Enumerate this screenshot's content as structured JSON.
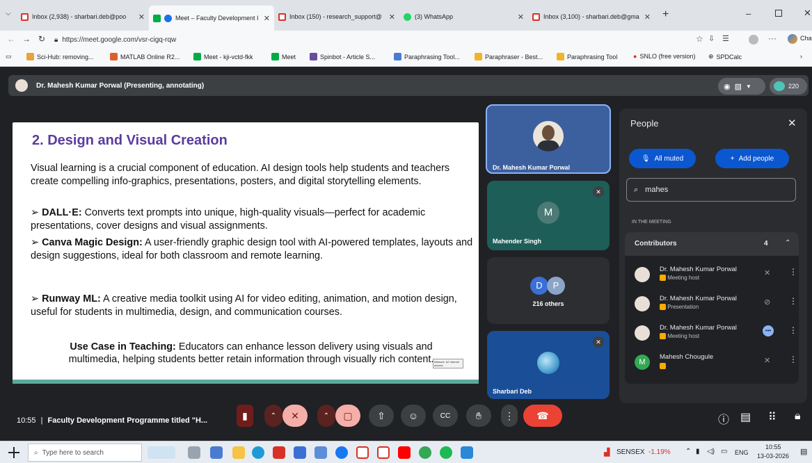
{
  "browser": {
    "tabs": [
      {
        "label": "Inbox (2,938) - sharbari.deb@poo"
      },
      {
        "label": "Meet – Faculty Development I"
      },
      {
        "label": "Inbox (150) - research_support@"
      },
      {
        "label": "(3) WhatsApp"
      },
      {
        "label": "Inbox (3,100) - sharbari.deb@gma"
      }
    ],
    "url": "https://meet.google.com/vsr-cigq-rqw",
    "chat_label": "Chat",
    "bookmarks": [
      "Sci-Hub: removing...",
      "MATLAB Online R2...",
      "Meet - kji-vctd-fkk",
      "Meet",
      "Spinbot - Article S...",
      "Paraphrasing Tool...",
      "Paraphraser - Best...",
      "Paraphrasing Tool",
      "SNLO (free version)",
      "SPDCalc"
    ]
  },
  "meet": {
    "presenter": "Dr. Mahesh Kumar Porwal (Presenting, annotating)",
    "participant_count": "220",
    "slide": {
      "title": "2. Design and Visual Creation",
      "intro": "Visual learning is a crucial component of education. AI design tools help students and teachers create compelling info-graphics, presentations, posters, and digital storytelling elements.",
      "bullets": [
        {
          "head": "DALL·E:",
          "text": " Converts text prompts into unique, high-quality visuals—perfect for academic presentations, cover designs and visual assignments."
        },
        {
          "head": "Canva Magic Design:",
          "text": " A user-friendly graphic design tool with AI-powered templates, layouts and design suggestions, ideal for both classroom and remote learning."
        },
        {
          "head": "Runway ML:",
          "text": " A creative media toolkit using AI for video editing, animation, and motion design, useful for students in multimedia, design, and communication courses."
        }
      ],
      "usecase_head": "Use Case in Teaching:",
      "usecase_text": " Educators can enhance lesson delivery using visuals and multimedia, helping students better retain information through visually rich content.",
      "tooltip": "Network: #2 Internet access"
    },
    "tiles": [
      {
        "name": "Dr. Mahesh Kumar Porwal"
      },
      {
        "name": "Mahender Singh",
        "initial": "M"
      },
      {
        "name": "216 others",
        "initials": [
          "D",
          "P"
        ]
      },
      {
        "name": "Sharbari Deb"
      }
    ],
    "people": {
      "title": "People",
      "all_muted": "All muted",
      "add_people": "Add people",
      "search_value": "mahes",
      "section": "IN THE MEETING",
      "group": "Contributors",
      "group_count": "4",
      "rows": [
        {
          "name": "Dr. Mahesh Kumar Porwal",
          "role": "Meeting host"
        },
        {
          "name": "Dr. Mahesh Kumar Porwal",
          "role": "Presentation"
        },
        {
          "name": "Dr. Mahesh Kumar Porwal",
          "role": "Meeting host"
        },
        {
          "name": "Mahesh Chougule",
          "role": "",
          "initial": "M"
        }
      ]
    },
    "bottom": {
      "time": "10:55",
      "separator": "|",
      "meeting_title": "Faculty Development Programme titled \"H..."
    }
  },
  "taskbar": {
    "search_placeholder": "Type here to search",
    "market_name": "SENSEX",
    "market_change": "-1.19%",
    "lang": "ENG",
    "time": "10:55",
    "date": "13-03-2026"
  },
  "colors": {
    "meet_bg": "#202124",
    "accent_blue": "#8ab4f8",
    "mute_red": "#6f1d1b",
    "end_red": "#ea4335",
    "slide_title": "#5b3b9e"
  }
}
